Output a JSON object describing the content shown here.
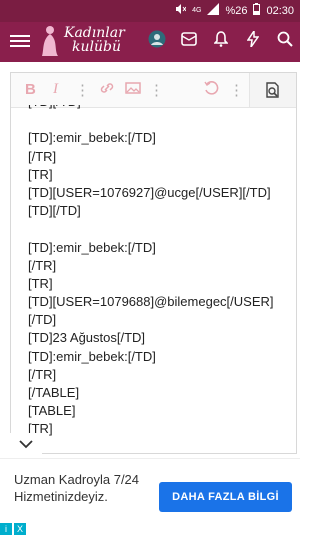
{
  "status": {
    "signal_label": "4G",
    "battery": "%26",
    "time": "02:30"
  },
  "app": {
    "logo_line1": "Kadınlar",
    "logo_line2": "kulübü"
  },
  "editor": {
    "toolbar": {
      "bold": "B",
      "italic": "I"
    },
    "lines": [
      "[TD]:emir_bebek:[/TD]",
      "[/TR]",
      "[TR]",
      "[TD][USER=1076927]@ucge[/USER][/TD]",
      "[TD][/TD]",
      "",
      "[TD]:emir_bebek:[/TD]",
      "[/TR]",
      "[TR]",
      "[TD][USER=1079688]@bilemegec[/USER]",
      "[/TD]",
      "[TD]23 Ağustos[/TD]",
      "[TD]:emir_bebek:[/TD]",
      "[/TR]",
      "[/TABLE]",
      "[TABLE]",
      "[TR]"
    ]
  },
  "ad": {
    "text": "Uzman Kadroyla 7/24 Hizmetinizdeyiz.",
    "button_label": "DAHA FAZLA BİLGİ",
    "choice_info": "i",
    "choice_close": "X"
  },
  "colors": {
    "statusbar": "#7a1d42",
    "appbar": "#8a1f4c",
    "button": "#1a73e8"
  }
}
